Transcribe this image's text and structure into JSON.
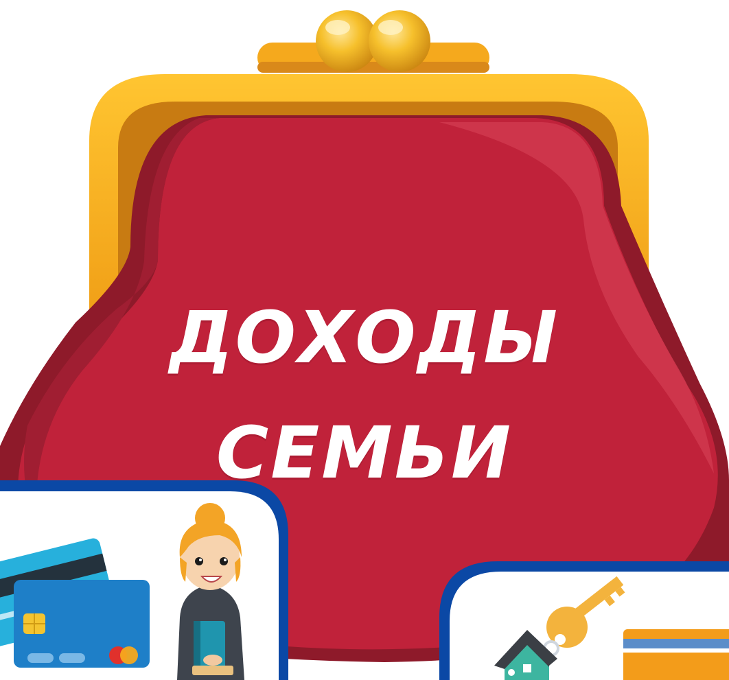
{
  "title": {
    "line1": "ДОХОДЫ",
    "line2": "СЕМЬИ"
  },
  "colors": {
    "purse_red": "#C0223A",
    "purse_dark": "#8E1A2A",
    "frame_gold": "#F5A91D",
    "frame_dark": "#C87B12",
    "card_border": "#0B48A5",
    "card_blue": "#1E7FC8",
    "card_orange": "#F39C1A",
    "key_yellow": "#F3B33D",
    "house_teal": "#3DB5A0"
  },
  "icons": [
    "purse-icon",
    "credit-card-icon",
    "woman-with-book-icon",
    "house-key-icon",
    "orange-card-icon"
  ]
}
